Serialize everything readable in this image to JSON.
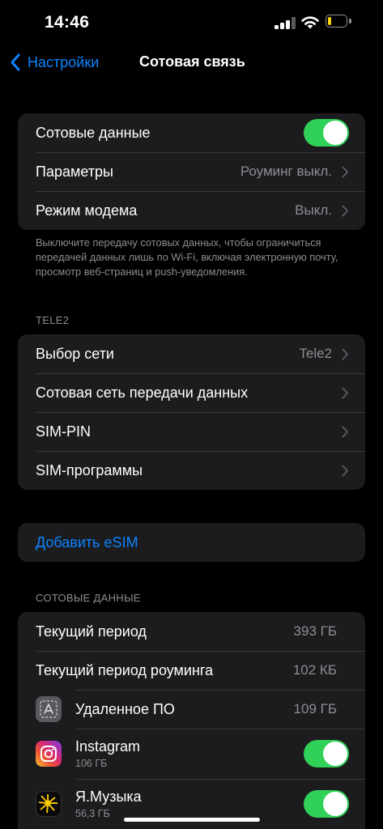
{
  "status": {
    "time": "14:46",
    "signal_bars_active": 3,
    "signal_bars_total": 4,
    "battery_level": 0.2,
    "battery_color": "#ffd60a"
  },
  "nav": {
    "back_label": "Настройки",
    "title": "Сотовая связь"
  },
  "group1": {
    "cellular_data_label": "Сотовые данные",
    "cellular_data_on": true,
    "options_label": "Параметры",
    "options_value": "Роуминг выкл.",
    "hotspot_label": "Режим модема",
    "hotspot_value": "Выкл."
  },
  "footnote": "Выключите передачу сотовых данных, чтобы ограничиться передачей данных лишь по Wi‑Fi, включая электронную почту, просмотр веб‑страниц и push‑уведомления.",
  "carrier_header": "TELE2",
  "group2": {
    "network_label": "Выбор сети",
    "network_value": "Tele2",
    "data_network_label": "Сотовая сеть передачи данных",
    "sim_pin_label": "SIM-PIN",
    "sim_apps_label": "SIM-программы"
  },
  "esim": {
    "add_label": "Добавить eSIM"
  },
  "data_header": "СОТОВЫЕ ДАННЫЕ",
  "usage": {
    "current_period_label": "Текущий период",
    "current_period_value": "393 ГБ",
    "roaming_period_label": "Текущий период роуминга",
    "roaming_period_value": "102 КБ",
    "apps": [
      {
        "name": "Удаленное ПО",
        "value": "109 ГБ",
        "icon": "remote-management-icon"
      },
      {
        "name": "Instagram",
        "sub": "106 ГБ",
        "icon": "instagram-icon",
        "enabled": true
      },
      {
        "name": "Я.Музыка",
        "sub": "56,3 ГБ",
        "icon": "yandex-music-icon",
        "enabled": true
      }
    ]
  },
  "colors": {
    "accent": "#0a84ff",
    "toggle_on": "#30d158",
    "cell_bg": "#1c1c1e",
    "secondary_text": "#8e8e93"
  }
}
